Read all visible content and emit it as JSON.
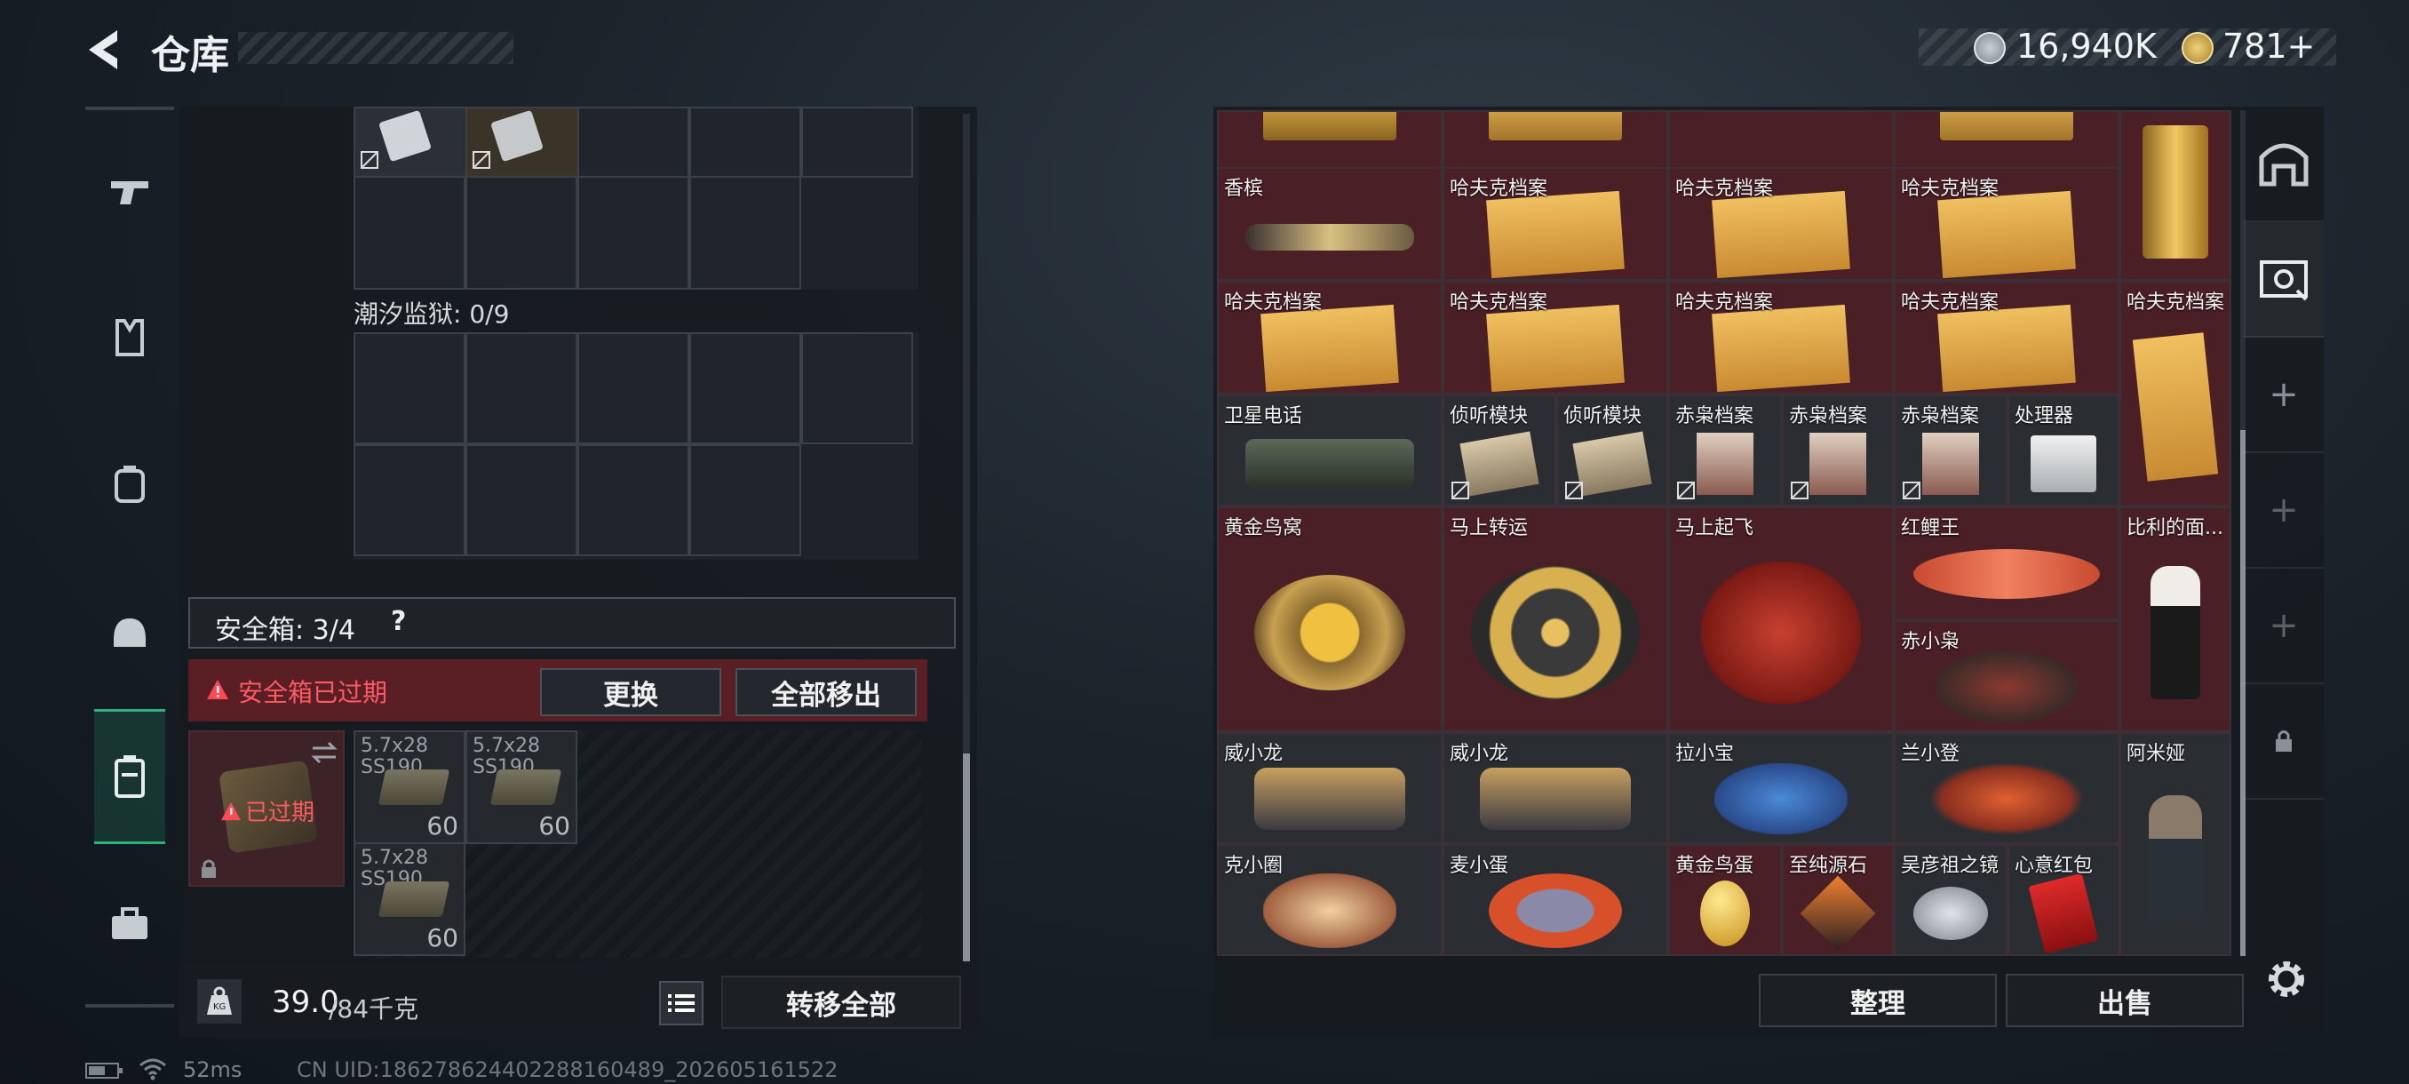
{
  "header": {
    "title": "仓库",
    "currency1": "16,940K",
    "currency2": "781+"
  },
  "left": {
    "container2_label": "潮汐监狱: 0/9",
    "safebox_label": "安全箱: 3/4",
    "safebox_help": "?",
    "expired_warning": "安全箱已过期",
    "replace_button": "更换",
    "move_all_out_button": "全部移出",
    "box_expired": "已过期",
    "ammo": [
      {
        "name": "5.7x28\nSS190",
        "count": "60"
      },
      {
        "name": "5.7x28\nSS190",
        "count": "60"
      },
      {
        "name": "5.7x28\nSS190",
        "count": "60"
      }
    ],
    "weight_value": "39.0",
    "weight_max": "/84千克",
    "transfer_all_button": "转移全部"
  },
  "status": {
    "ping": "52ms",
    "uid": "CN UID:18627862440228816048​9_202605161522"
  },
  "stash_items": [
    {
      "label": "香槟"
    },
    {
      "label": "哈夫克档案"
    },
    {
      "label": "哈夫克档案"
    },
    {
      "label": "哈夫克档案"
    },
    {
      "label": "哈夫克档案"
    },
    {
      "label": "哈夫克档案"
    },
    {
      "label": "哈夫克档案"
    },
    {
      "label": "哈夫克档案"
    },
    {
      "label": "哈夫克档案"
    },
    {
      "label": "卫星电话"
    },
    {
      "label": "侦听模块"
    },
    {
      "label": "侦听模块"
    },
    {
      "label": "赤枭档案"
    },
    {
      "label": "赤枭档案"
    },
    {
      "label": "赤枭档案"
    },
    {
      "label": "处理器"
    },
    {
      "label": "黄金鸟窝"
    },
    {
      "label": "马上转运"
    },
    {
      "label": "马上起飞"
    },
    {
      "label": "红鲤王"
    },
    {
      "label": "比利的面..."
    },
    {
      "label": "赤小枭"
    },
    {
      "label": "威小龙"
    },
    {
      "label": "威小龙"
    },
    {
      "label": "拉小宝"
    },
    {
      "label": "兰小登"
    },
    {
      "label": "阿米娅"
    },
    {
      "label": "克小圈"
    },
    {
      "label": "麦小蛋"
    },
    {
      "label": "黄金鸟蛋"
    },
    {
      "label": "至纯源石"
    },
    {
      "label": "吴彦祖之镜"
    },
    {
      "label": "心意红包"
    }
  ],
  "right_buttons": {
    "sort": "整理",
    "sell": "出售"
  },
  "colors": {
    "accent_green": "#2fb27a",
    "warning_red": "#e0404a",
    "item_red": "#4a1f26"
  }
}
